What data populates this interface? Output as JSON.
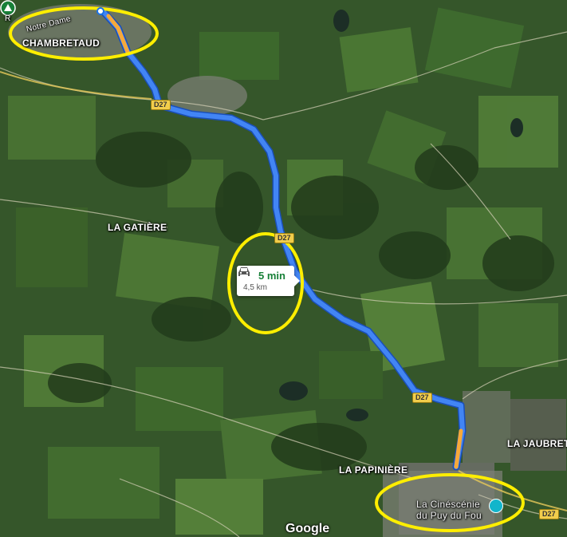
{
  "map": {
    "provider": "Google",
    "imagery": "satellite",
    "route_color": "#4285f4",
    "highlight_color": "#ffff00"
  },
  "places": {
    "chambretaud": "CHAMBRETAUD",
    "notre_dame": "Notre Dame",
    "la_gatiere": "LA GATIÈRE",
    "la_papiniere": "LA PAPINIÈRE",
    "la_jaubret": "LA JAUBRET",
    "poi_line1": "La Cinéscénie",
    "poi_line2": "du Puy du Fou",
    "street_prefix": "R"
  },
  "road_shields": {
    "d27_a": "D27",
    "d27_b": "D27",
    "d27_c": "D27",
    "d27_d": "D27"
  },
  "route_card": {
    "duration": "5 min",
    "distance": "4,5 km"
  },
  "icons": {
    "car": "car-icon",
    "camp": "campground-icon",
    "poi": "theater-icon",
    "start": "start-point-icon"
  },
  "logo": "Google"
}
